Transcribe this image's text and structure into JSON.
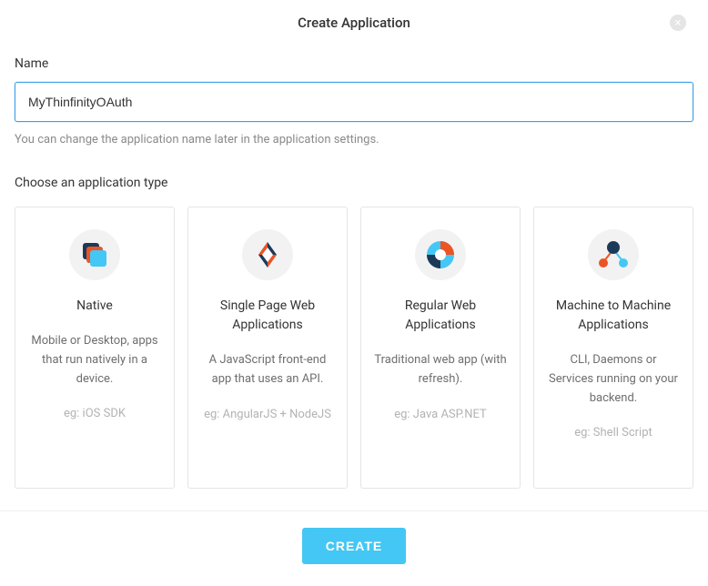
{
  "modal": {
    "title": "Create Application",
    "close_icon": "×"
  },
  "name_field": {
    "label": "Name",
    "value": "MyThinfinityOAuth",
    "help": "You can change the application name later in the application settings."
  },
  "type_section": {
    "label": "Choose an application type"
  },
  "cards": [
    {
      "title": "Native",
      "desc": "Mobile or Desktop, apps that run natively in a device.",
      "example": "eg: iOS SDK"
    },
    {
      "title": "Single Page Web Applications",
      "desc": "A JavaScript front-end app that uses an API.",
      "example": "eg: AngularJS + NodeJS"
    },
    {
      "title": "Regular Web Applications",
      "desc": "Traditional web app (with refresh).",
      "example": "eg: Java ASP.NET"
    },
    {
      "title": "Machine to Machine Applications",
      "desc": "CLI, Daemons or Services running on your backend.",
      "example": "eg: Shell Script"
    }
  ],
  "footer": {
    "create_label": "CREATE"
  }
}
